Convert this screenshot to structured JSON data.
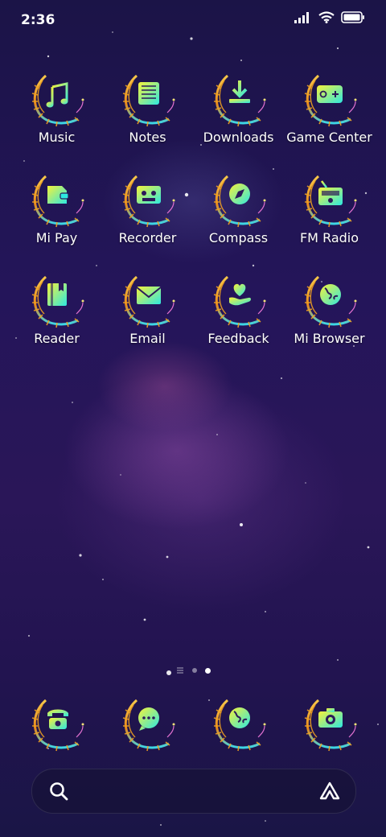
{
  "status_bar": {
    "time": "2:36",
    "icons": [
      "signal-icon",
      "wifi-icon",
      "battery-icon"
    ]
  },
  "apps": [
    {
      "label": "Music",
      "icon": "music-note-icon"
    },
    {
      "label": "Notes",
      "icon": "notes-icon"
    },
    {
      "label": "Downloads",
      "icon": "download-icon"
    },
    {
      "label": "Game Center",
      "icon": "gamepad-icon"
    },
    {
      "label": "Mi Pay",
      "icon": "wallet-icon"
    },
    {
      "label": "Recorder",
      "icon": "cassette-icon"
    },
    {
      "label": "Compass",
      "icon": "compass-icon"
    },
    {
      "label": "FM Radio",
      "icon": "radio-icon"
    },
    {
      "label": "Reader",
      "icon": "book-icon"
    },
    {
      "label": "Email",
      "icon": "envelope-icon"
    },
    {
      "label": "Feedback",
      "icon": "heart-hand-icon"
    },
    {
      "label": "Mi Browser",
      "icon": "globe-icon"
    }
  ],
  "page_indicator": {
    "pages": 2,
    "current": 2
  },
  "dock": [
    {
      "icon": "phone-icon"
    },
    {
      "icon": "message-icon"
    },
    {
      "icon": "globe-icon"
    },
    {
      "icon": "camera-icon"
    }
  ],
  "search_bar": {
    "icons": [
      "search-icon",
      "assistant-icon"
    ]
  },
  "colors": {
    "icon_gradient_start": "#f6f23a",
    "icon_gradient_end": "#2ee8e0",
    "feather_orange": "#f0a020",
    "background": "#22155a"
  }
}
